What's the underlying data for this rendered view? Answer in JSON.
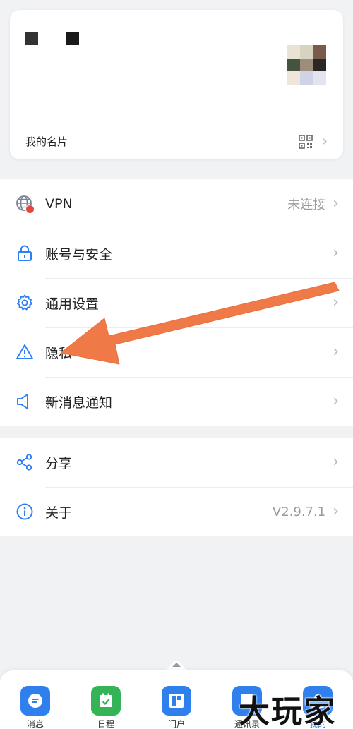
{
  "profile": {
    "card_label": "我的名片"
  },
  "groups": [
    {
      "rows": [
        {
          "name": "vpn",
          "label": "VPN",
          "value": "未连接",
          "icon": "globe-icon"
        },
        {
          "name": "account-security",
          "label": "账号与安全",
          "value": "",
          "icon": "lock-icon"
        },
        {
          "name": "general-settings",
          "label": "通用设置",
          "value": "",
          "icon": "gear-icon"
        },
        {
          "name": "privacy",
          "label": "隐私",
          "value": "",
          "icon": "warning-icon"
        },
        {
          "name": "notifications",
          "label": "新消息通知",
          "value": "",
          "icon": "speaker-icon"
        }
      ]
    },
    {
      "rows": [
        {
          "name": "share",
          "label": "分享",
          "value": "",
          "icon": "share-icon"
        },
        {
          "name": "about",
          "label": "关于",
          "value": "V2.9.7.1",
          "icon": "info-icon"
        }
      ]
    }
  ],
  "vpn_badge": "!",
  "chevron": "›",
  "nav": [
    {
      "label": "消息",
      "icon": "message-icon",
      "color": "#2f80ed"
    },
    {
      "label": "日程",
      "icon": "calendar-icon",
      "color": "#35b457"
    },
    {
      "label": "门户",
      "icon": "portal-icon",
      "color": "#2f80ed"
    },
    {
      "label": "通讯录",
      "icon": "contacts-icon",
      "color": "#2f80ed"
    },
    {
      "label": "我的",
      "icon": "profile-icon",
      "color": "#2f80ed",
      "active": true
    }
  ],
  "watermark": "大玩家",
  "colors": {
    "accent": "#2d7ef7",
    "arrow": "#f07a47",
    "badge": "#e2483d"
  }
}
